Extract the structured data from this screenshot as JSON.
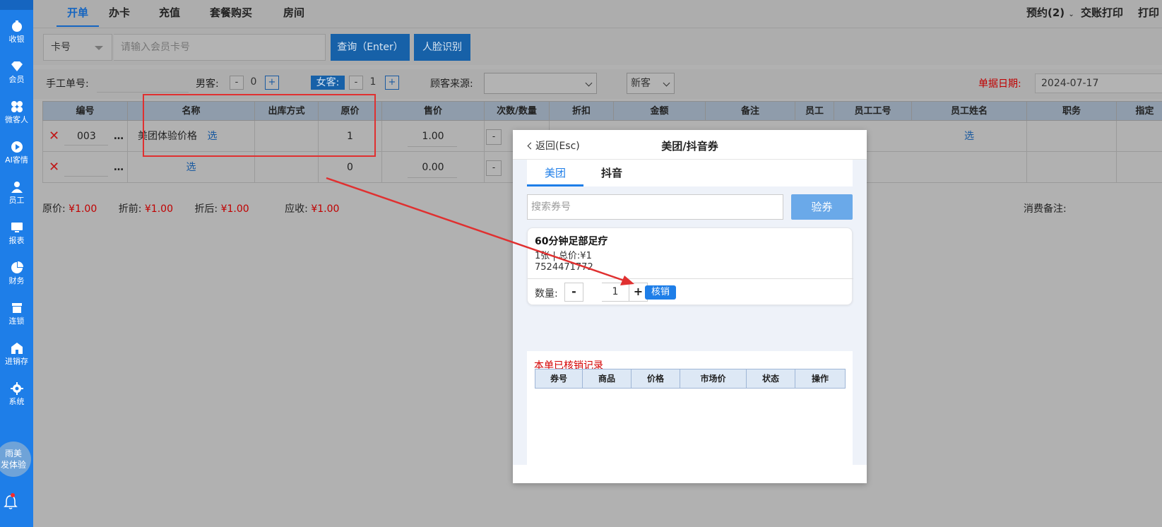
{
  "sidebar": {
    "items": [
      {
        "label": "收银",
        "icon": "cash-register-icon"
      },
      {
        "label": "会员",
        "icon": "diamond-icon"
      },
      {
        "label": "微客人",
        "icon": "grid-icon"
      },
      {
        "label": "AI客情",
        "icon": "play-circle-icon"
      },
      {
        "label": "员工",
        "icon": "person-icon"
      },
      {
        "label": "报表",
        "icon": "monitor-icon"
      },
      {
        "label": "财务",
        "icon": "pie-chart-icon"
      },
      {
        "label": "连锁",
        "icon": "store-icon"
      },
      {
        "label": "进销存",
        "icon": "warehouse-icon"
      },
      {
        "label": "系统",
        "icon": "gear-icon"
      }
    ],
    "avatar_line1": "雨美",
    "avatar_line2": "发体验"
  },
  "topnav": {
    "tabs": [
      "开单",
      "办卡",
      "充值",
      "套餐购买",
      "房间"
    ],
    "active_tab": "开单",
    "reservation": "预约(2)",
    "handover_print": "交账打印",
    "print": "打印"
  },
  "search": {
    "card_type": "卡号",
    "placeholder": "请输入会员卡号",
    "query_button": "查询（Enter）",
    "face_button": "人脸识别"
  },
  "form": {
    "manual_no_label": "手工单号:",
    "male_label": "男客:",
    "male_count": "0",
    "female_label": "女客:",
    "female_count": "1",
    "source_label": "顾客来源:",
    "source_value": "",
    "customer_type": "新客",
    "date_label": "单据日期:",
    "date_value": "2024-07-17"
  },
  "table": {
    "headers": [
      "编号",
      "名称",
      "出库方式",
      "原价",
      "售价",
      "次数/数量",
      "折扣",
      "金额",
      "备注",
      "员工",
      "员工工号",
      "员工姓名",
      "职务",
      "指定"
    ],
    "rows": [
      {
        "code": "003",
        "name": "美团体验价格",
        "select": "选",
        "price": "1",
        "sale": "1.00",
        "staff_select": "选"
      },
      {
        "code": "",
        "name": "",
        "select": "选",
        "price": "0",
        "sale": "0.00",
        "staff_select": ""
      }
    ]
  },
  "summary": {
    "orig_label": "原价:",
    "orig_value": "¥1.00",
    "before_label": "折前:",
    "before_value": "¥1.00",
    "after_label": "折后:",
    "after_value": "¥1.00",
    "due_label": "应收:",
    "due_value": "¥1.00",
    "remark_label": "消费备注:"
  },
  "modal": {
    "back": "返回(Esc)",
    "title": "美团/抖音券",
    "tabs": [
      "美团",
      "抖音"
    ],
    "voucher_placeholder": "搜索券号",
    "verify_button": "验券",
    "coupon": {
      "name": "60分钟足部足疗",
      "info": "1张 | 总价:¥1",
      "code": "7524471772",
      "qty_label": "数量:",
      "qty": "1",
      "minus": "-",
      "plus": "+",
      "redeem": "核销"
    },
    "records_title": "本单已核销记录",
    "records_headers": [
      "券号",
      "商品",
      "价格",
      "市场价",
      "状态",
      "操作"
    ]
  },
  "colors": {
    "sidebar": "#1e7ee8",
    "accent": "#1e7ee8",
    "highlight": "#e03030",
    "price_red": "#c00000"
  }
}
